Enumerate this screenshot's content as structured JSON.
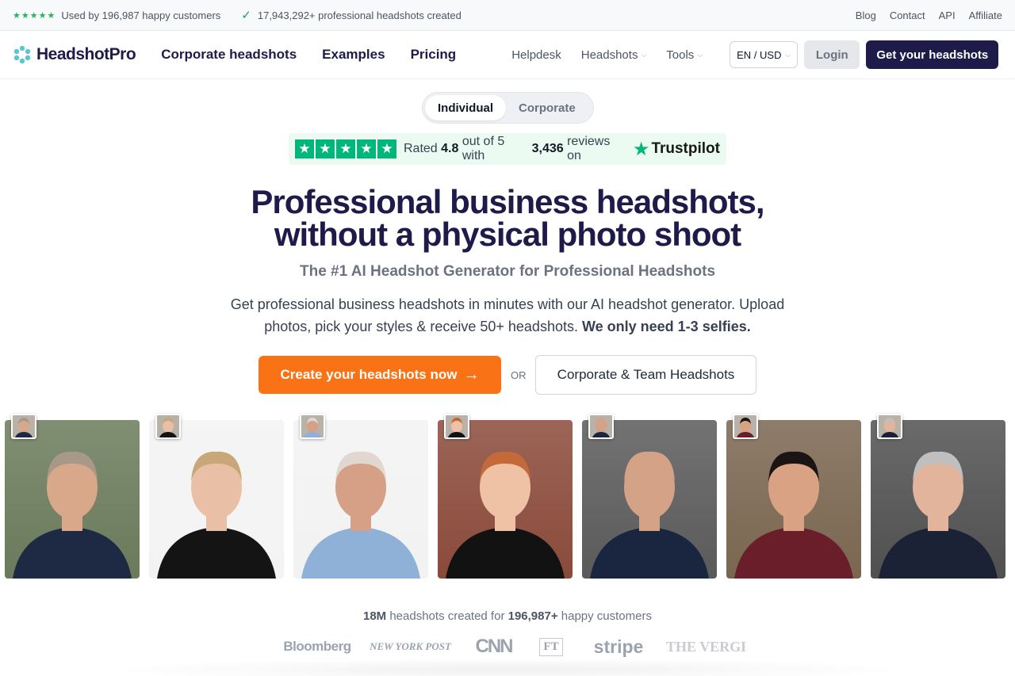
{
  "topbar": {
    "customers_text": "Used by 196,987 happy customers",
    "created_text": "17,943,292+ professional headshots created",
    "links": [
      "Blog",
      "Contact",
      "API",
      "Affiliate"
    ]
  },
  "nav": {
    "logo": "HeadshotPro",
    "main_links": [
      "Corporate headshots",
      "Examples",
      "Pricing"
    ],
    "sub_links": [
      "Helpdesk",
      "Headshots",
      "Tools"
    ],
    "lang": "EN / USD",
    "login": "Login",
    "cta": "Get your headshots"
  },
  "toggle": {
    "options": [
      "Individual",
      "Corporate"
    ],
    "selected": "Individual"
  },
  "trustpilot": {
    "rated": "Rated",
    "rating": "4.8",
    "out_of": "out of 5 with",
    "reviews": "3,436",
    "reviews_on": "reviews on",
    "brand": "Trustpilot"
  },
  "hero": {
    "title_line1": "Professional business headshots,",
    "title_line2": "without a physical photo shoot",
    "subtitle": "The #1 AI Headshot Generator for Professional Headshots",
    "description": "Get professional business headshots in minutes with our AI headshot generator. Upload photos, pick your styles & receive 50+ headshots.",
    "description_bold": "We only need 1-3 selfies.",
    "primary_cta": "Create your headshots now",
    "or": "OR",
    "secondary_cta": "Corporate & Team Headshots"
  },
  "photos": [
    {
      "name": "headshot-man-park",
      "bg": "#6a7a5a",
      "suit": "#1e2a44",
      "skin": "#d9a88a",
      "hair": "#a89888"
    },
    {
      "name": "headshot-woman-blonde",
      "bg": "#f3f3f3",
      "suit": "#141414",
      "skin": "#e9bfa6",
      "hair": "#c8a878"
    },
    {
      "name": "headshot-man-blue-shirt",
      "bg": "#f2f2f2",
      "suit": "#8fb1d8",
      "skin": "#d6a086",
      "hair": "#e0d8d0"
    },
    {
      "name": "headshot-woman-redhead",
      "bg": "#8a4a3a",
      "suit": "#121212",
      "skin": "#efc2a6",
      "hair": "#c46a3a"
    },
    {
      "name": "headshot-man-bald",
      "bg": "#5a5a5a",
      "suit": "#1a2640",
      "skin": "#d3a287",
      "hair": "#d3a287"
    },
    {
      "name": "headshot-woman-dark-hair",
      "bg": "#7a6650",
      "suit": "#6a1e2a",
      "skin": "#d9a283",
      "hair": "#1a1414"
    },
    {
      "name": "headshot-man-glasses",
      "bg": "#505050",
      "suit": "#1c2236",
      "skin": "#e2b49c",
      "hair": "#bfbfbf"
    }
  ],
  "stats": {
    "count": "18M",
    "text1": "headshots created for",
    "customers": "196,987+",
    "text2": "happy customers"
  },
  "press_logos": [
    "Bloomberg",
    "NEW YORK POST",
    "CNN",
    "FT",
    "stripe",
    "THE VERGE"
  ],
  "colors": {
    "navy": "#1e1b4b",
    "orange": "#f97316",
    "trustpilot_green": "#00b67a"
  }
}
